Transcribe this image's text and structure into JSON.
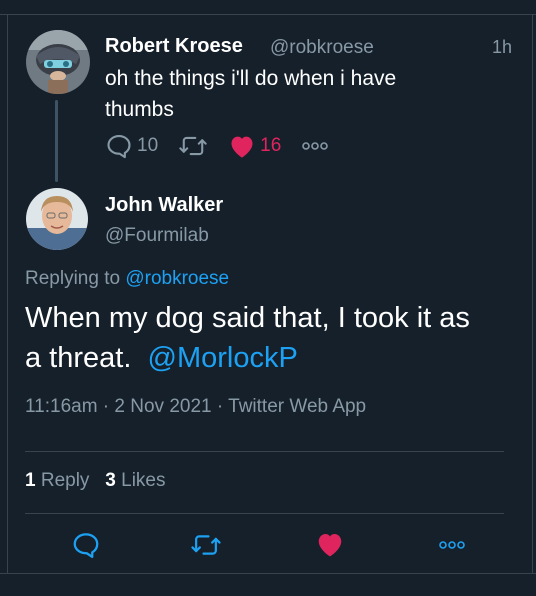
{
  "parent_tweet": {
    "author_name": "Robert Kroese",
    "author_handle": "@robkroese",
    "time_ago": "1h",
    "text_line1": "oh the things i'll do when i have",
    "text_line2": "thumbs",
    "reply_count": "10",
    "like_count": "16"
  },
  "reply_tweet": {
    "author_name": "John Walker",
    "author_handle": "@Fourmilab",
    "replying_prefix": "Replying to",
    "replying_handle": "@robkroese",
    "text_line1": "When my dog said that, I took it as",
    "text_line2_prefix": "a threat.",
    "mention": "@MorlockP",
    "timestamp": "11:16am · 2 Nov 2021 · Twitter Web App",
    "stats": {
      "replies_count": "1",
      "replies_label": "Reply",
      "likes_count": "3",
      "likes_label": "Likes"
    }
  },
  "colors": {
    "background": "#15202b",
    "muted": "#8899a6",
    "link": "#1da1f2",
    "like": "#e0245e",
    "divider": "#38444d"
  },
  "icons": {
    "reply": "speech-bubble-icon",
    "retweet": "retweet-icon",
    "like": "heart-icon",
    "more": "more-dots-icon"
  }
}
